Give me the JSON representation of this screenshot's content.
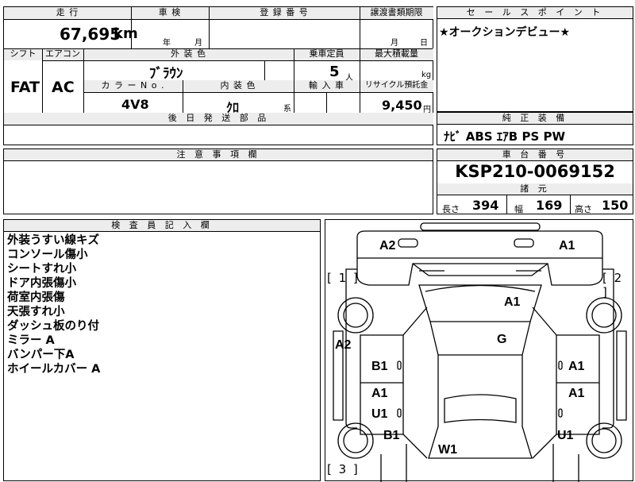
{
  "top": {
    "mileage_header": "走 行",
    "mileage_value": "67,695",
    "mileage_unit": "km",
    "inspection_header": "車 検",
    "inspection_year": "年",
    "inspection_month": "月",
    "registration_header": "登 録 番 号",
    "transfer_header": "譲渡書類期限",
    "transfer_month": "月",
    "transfer_day": "日",
    "shift_header": "シフト",
    "shift_value": "FAT",
    "aircon_header": "エアコン",
    "aircon_value": "AC",
    "exterior_color_header": "外 装 色",
    "exterior_color_value": "ﾌﾞﾗｳﾝ",
    "capacity_header": "乗車定員",
    "capacity_value": "5",
    "capacity_unit": "人",
    "load_header": "最大積載量",
    "load_unit": "kg",
    "color_no_header": "カ ラ ー N o .",
    "color_no_value": "4V8",
    "interior_header": "内 装 色",
    "interior_value": "ｸﾛ",
    "interior_suffix": "系",
    "import_header": "輸 入 車",
    "recycle_header": "リサイクル預託金",
    "recycle_value": "9,450",
    "recycle_unit": "円",
    "parts_header": "後 日 発 送 部 品"
  },
  "sales": {
    "header": "セ ー ル ス ポ イ ン ト",
    "text": "★オークションデビュー★"
  },
  "equipment": {
    "header": "純 正 装 備",
    "text": "ﾅﾋﾞ ABS ｴｱB PS PW"
  },
  "caution": {
    "header": "注 意 事 項 欄"
  },
  "chassis": {
    "header": "車 台 番 号",
    "value": "KSP210-0069152",
    "specs_header": "諸 元",
    "length_label": "長さ",
    "length_value": "394",
    "width_label": "幅",
    "width_value": "169",
    "height_label": "高さ",
    "height_value": "150"
  },
  "inspector": {
    "header": "検 査 員 記 入 欄",
    "notes": [
      "外装うすい線キズ",
      "コンソール傷小",
      "シートすれ小",
      "ドア内張傷小",
      "荷室内張傷",
      "天張すれ小",
      "ダッシュ板のり付",
      "ミラー A",
      "バンパー下A",
      "ホイールカバー A"
    ]
  },
  "diagram": {
    "corner_1": "[ 1 ]",
    "corner_2": "[ 2 ]",
    "corner_3": "[ 3 ]",
    "marks": {
      "front_left": "A2",
      "front_right": "A1",
      "hood": "A1",
      "left_fender": "A2",
      "windshield": "G",
      "left_front_door": "B1",
      "right_front_door": "A1",
      "left_rear_door_a": "A1",
      "left_rear_door_u": "U1",
      "right_rear_door": "A1",
      "left_rear": "B1",
      "right_rear": "U1",
      "rear_glass": "W1"
    }
  }
}
